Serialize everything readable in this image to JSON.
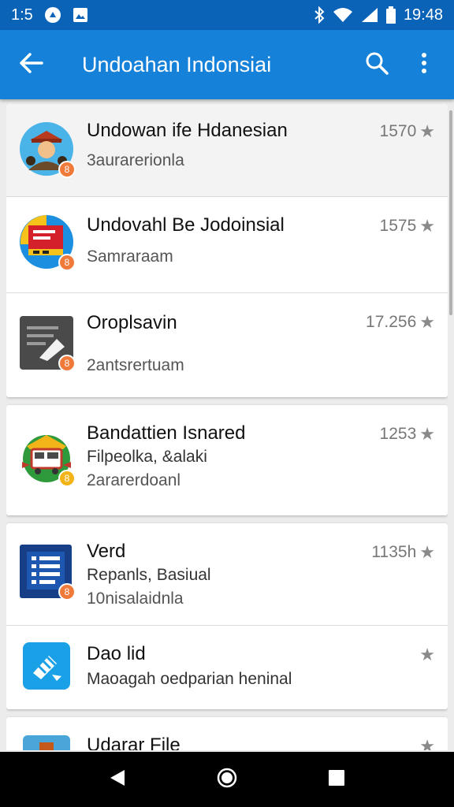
{
  "status_bar": {
    "left_text": "1:5",
    "time": "19:48",
    "icons": [
      "app-notification-icon",
      "photo-notification-icon",
      "bluetooth-icon",
      "wifi-icon",
      "signal-icon",
      "battery-icon"
    ]
  },
  "app_bar": {
    "title": "Undoahan Indonsiai",
    "icons": [
      "back-arrow-icon",
      "search-icon",
      "more-vert-icon"
    ]
  },
  "colors": {
    "status_bar": "#0b63b8",
    "app_bar": "#1681d9",
    "badge": "#ef7a3a"
  },
  "cards": [
    {
      "items": [
        {
          "name": "Undowan ife Hdanesian",
          "line1": "3aurarerionla",
          "line2": "",
          "meta": "1570",
          "icon": "person-avatar-icon",
          "badge": "8"
        },
        {
          "name": "Undovahl Be Jodoinsial",
          "line1": "Samraraam",
          "line2": "",
          "meta": "1575",
          "icon": "flag-book-icon",
          "badge": "8"
        },
        {
          "name": "Oroplsavin",
          "line1": "2antsrertuam",
          "line2": "",
          "meta": "17.256",
          "icon": "document-edit-icon",
          "badge": "8"
        }
      ]
    },
    {
      "items": [
        {
          "name": "Bandattien Isnared",
          "line1": "Filpeolka, &alaki",
          "line2": "2ararerdoanl",
          "meta": "1253",
          "icon": "bus-emblem-icon",
          "badge": "8"
        }
      ]
    },
    {
      "items": [
        {
          "name": "Verd",
          "line1": "Repanls, Basiual",
          "line2": "10nisalaidnla",
          "meta": "1135h",
          "icon": "list-document-icon",
          "badge": "8"
        },
        {
          "name": "Dao lid",
          "line1": "Maoagah oedparian heninal",
          "line2": "",
          "meta": "",
          "icon": "tools-icon",
          "badge": ""
        }
      ]
    },
    {
      "items": [
        {
          "name": "Udarar File",
          "line1": "",
          "line2": "",
          "meta": "",
          "icon": "landscape-icon",
          "badge": ""
        }
      ]
    }
  ],
  "nav_bar": {
    "icons": [
      "nav-back-icon",
      "nav-home-icon",
      "nav-recents-icon"
    ]
  }
}
